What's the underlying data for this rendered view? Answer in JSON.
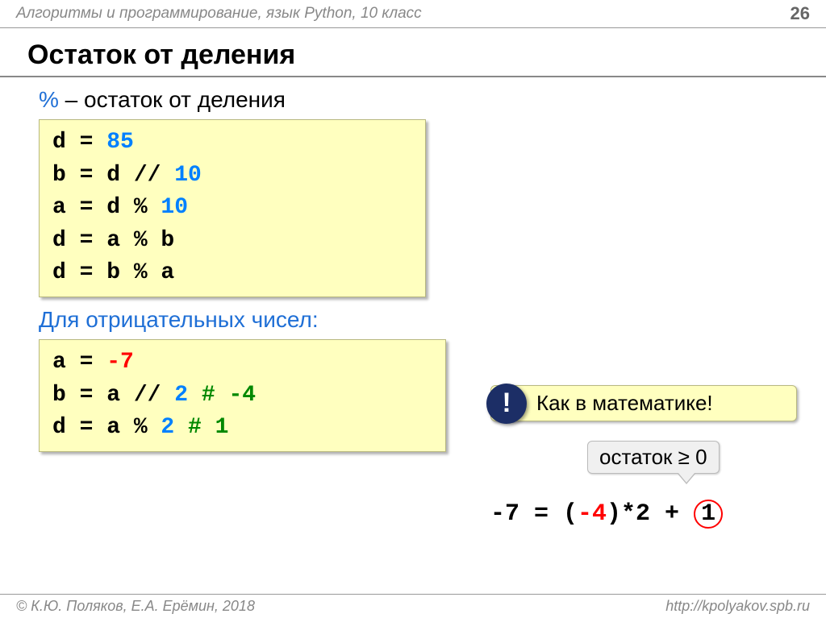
{
  "header": {
    "course": "Алгоритмы и программирование, язык Python, 10 класс",
    "page_num": "26"
  },
  "title": "Остаток от деления",
  "subtitle": {
    "op": "%",
    "text": " – остаток от деления"
  },
  "code_a": {
    "l1_lhs": "d = ",
    "l1_val": "85",
    "l2_lhs": "b = d // ",
    "l2_val": "10",
    "l3_lhs": "a = d % ",
    "l3_val": "10",
    "l4": "d = a % b",
    "l5": "d = b % a"
  },
  "subtitle2": "Для отрицательных чисел:",
  "code_b": {
    "l1_lhs": "a = ",
    "l1_val": "-7",
    "l2_lhs": "b = a // ",
    "l2_val": "2",
    "l2_comment": "  # -4",
    "l3_lhs": "d = a % ",
    "l3_val": "2",
    "l3_comment": "   # 1"
  },
  "callout_math": "Как в математике!",
  "excl": "!",
  "callout_rem": "остаток ≥ 0",
  "equation": {
    "p1": "-7  = (",
    "neg4": "-4",
    "p2": ")*2  + ",
    "one": "1"
  },
  "footer": {
    "left": "© К.Ю. Поляков, Е.А. Ерёмин, 2018",
    "right": "http://kpolyakov.spb.ru"
  }
}
